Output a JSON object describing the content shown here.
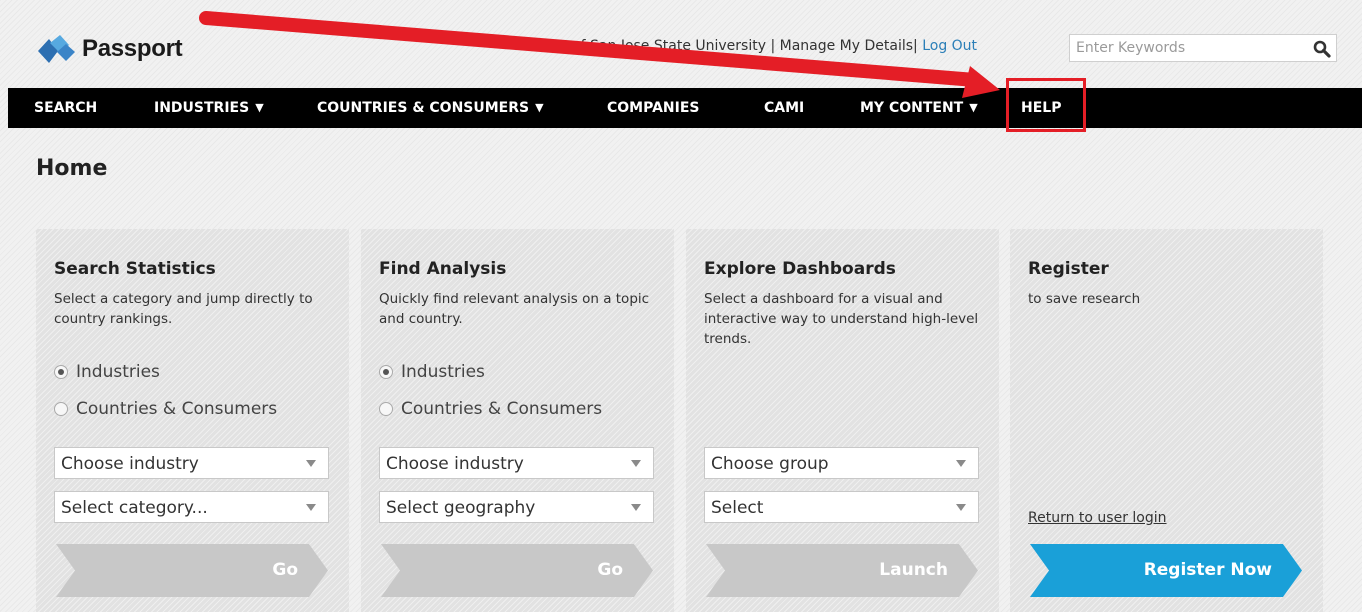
{
  "header": {
    "logo_text": "Passport",
    "account_text": "Part of San Jose State University | Manage My Details|",
    "logout_label": "Log Out",
    "search_placeholder": "Enter Keywords"
  },
  "nav": {
    "items": [
      {
        "label": "SEARCH",
        "has_dropdown": false
      },
      {
        "label": "INDUSTRIES",
        "has_dropdown": true
      },
      {
        "label": "COUNTRIES & CONSUMERS",
        "has_dropdown": true
      },
      {
        "label": "COMPANIES",
        "has_dropdown": false
      },
      {
        "label": "CAMI",
        "has_dropdown": false
      },
      {
        "label": "MY CONTENT",
        "has_dropdown": true
      },
      {
        "label": "HELP",
        "has_dropdown": false
      }
    ],
    "caret": "▼",
    "highlighted": "HELP",
    "highlight_color": "#e41e26"
  },
  "page": {
    "title": "Home"
  },
  "cards": [
    {
      "title": "Search Statistics",
      "desc": "Select a category and jump directly to country rankings.",
      "radios": [
        {
          "label": "Industries",
          "checked": true
        },
        {
          "label": "Countries & Consumers",
          "checked": false
        }
      ],
      "selects": [
        "Choose industry",
        "Select category..."
      ],
      "button": "Go"
    },
    {
      "title": "Find Analysis",
      "desc": "Quickly find relevant analysis on a topic and country.",
      "radios": [
        {
          "label": "Industries",
          "checked": true
        },
        {
          "label": "Countries & Consumers",
          "checked": false
        }
      ],
      "selects": [
        "Choose industry",
        "Select geography"
      ],
      "button": "Go"
    },
    {
      "title": "Explore Dashboards",
      "desc": "Select a dashboard for a visual and interactive way to understand high-level trends.",
      "selects": [
        "Choose group",
        "Select"
      ],
      "button": "Launch"
    },
    {
      "title": "Register",
      "desc": "to save research",
      "link": "Return to user login",
      "button": "Register Now"
    }
  ],
  "colors": {
    "nav_bg": "#000000",
    "link": "#2b7fb8",
    "register_button": "#1aa0d8",
    "disabled_button": "#c8c8c8",
    "annotation_arrow": "#e41e26"
  },
  "icons": [
    "passport-logo-icon",
    "search-icon",
    "annotation-arrow"
  ]
}
